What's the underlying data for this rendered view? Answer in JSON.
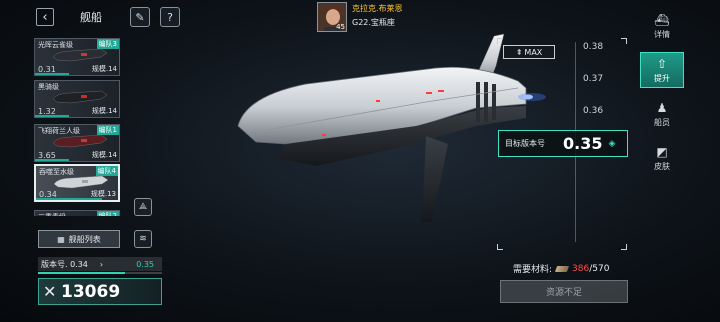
{
  "header": {
    "back_icon": "back-chevron-icon",
    "title": "舰船",
    "brush_icon": "brush-icon",
    "help_icon": "question-icon"
  },
  "ship_list": [
    {
      "name": "光晖云雀级",
      "fleet": "编队3",
      "version": "0.31",
      "scale": "规模.14",
      "selected": false,
      "hull_color": "#2a2e34",
      "accent": "#c23a3a"
    },
    {
      "name": "黑骑级",
      "fleet": "",
      "version": "1.32",
      "scale": "规模.14",
      "selected": false,
      "hull_color": "#1e2226",
      "accent": "#e02222"
    },
    {
      "name": "飞翔荷兰人级",
      "fleet": "编队1",
      "version": "3.65",
      "scale": "规模.14",
      "selected": false,
      "hull_color": "#5a1e22",
      "accent": "#c23a3a"
    },
    {
      "name": "吞噬至水级",
      "fleet": "编队4",
      "version": "0.34",
      "scale": "规模.13",
      "selected": true,
      "hull_color": "#cfd4d8",
      "accent": "#9aa2a8"
    },
    {
      "name": "三重奏级",
      "fleet": "编队2",
      "version": "",
      "scale": "",
      "selected": false,
      "hull_color": "#2a2e34",
      "accent": "#aaa"
    }
  ],
  "ship_list_button": {
    "icon": "grid-icon",
    "label": "舰船列表"
  },
  "version_row": {
    "label": "版本号. 0.34",
    "arrow": "›",
    "target": "0.35",
    "progress": 0.7
  },
  "power": {
    "icon": "crossed-swords-icon",
    "value": "13069"
  },
  "pilot": {
    "name": "克拉克.布莱恩",
    "class": "G22.宝瓶座",
    "level": "45"
  },
  "right_nav": [
    {
      "icon": "ship-icon",
      "label": "详情",
      "active": false
    },
    {
      "icon": "upgrade-icon",
      "label": "提升",
      "active": true
    },
    {
      "icon": "crew-icon",
      "label": "船员",
      "active": false
    },
    {
      "icon": "skin-icon",
      "label": "皮肤",
      "active": false
    }
  ],
  "upgrade": {
    "max_label": "MAX",
    "max_icon": "max-arrow-icon",
    "ticks": [
      "0.38",
      "0.37",
      "0.36"
    ],
    "target_label": "目标版本号",
    "target_value": "0.35",
    "target_icon": "diamond-icon"
  },
  "materials": {
    "label": "需要材料:",
    "have": "386",
    "separator": "/",
    "need": "570",
    "icon": "material-icon"
  },
  "action_button": {
    "label": "资源不足"
  }
}
